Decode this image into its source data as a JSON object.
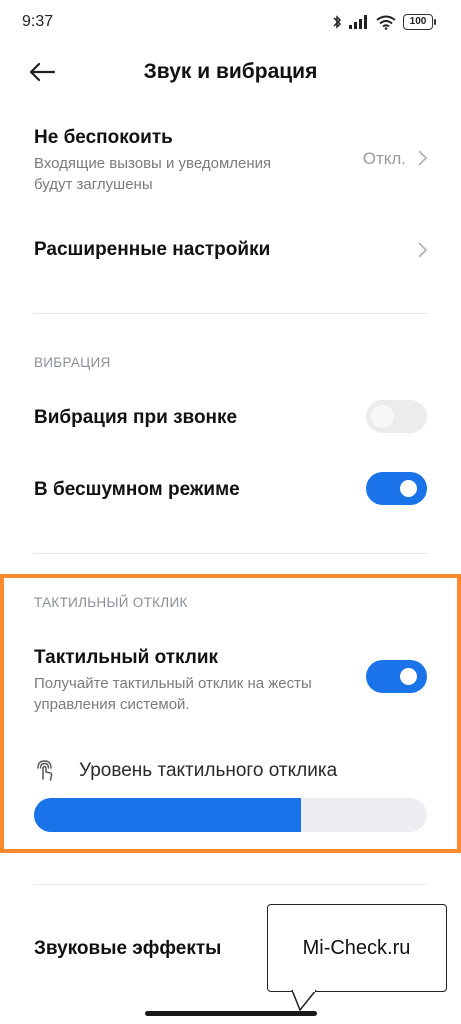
{
  "status_bar": {
    "time": "9:37",
    "battery": "100",
    "icons": [
      "bluetooth-icon",
      "signal-icon",
      "wifi-icon",
      "battery-icon"
    ]
  },
  "header": {
    "title": "Звук и вибрация",
    "back_icon": "arrow-left-icon"
  },
  "dnd": {
    "title": "Не беспокоить",
    "desc_line1": "Входящие вызовы и уведомления",
    "desc_line2": "будут заглушены",
    "value": "Откл."
  },
  "advanced": {
    "title": "Расширенные настройки"
  },
  "vibration_section": {
    "label": "ВИБРАЦИЯ",
    "ring_vibration": {
      "title": "Вибрация при звонке",
      "enabled": false
    },
    "silent_vibration": {
      "title": "В бесшумном режиме",
      "enabled": true
    }
  },
  "haptic_section": {
    "label": "ТАКТИЛЬНЫЙ ОТКЛИК",
    "haptic": {
      "title": "Тактильный отклик",
      "desc_line1": "Получайте тактильный отклик на жесты",
      "desc_line2": "управления системой.",
      "enabled": true
    },
    "level": {
      "label": "Уровень тактильного отклика",
      "icon": "touch-vibration-icon",
      "value_fraction": 0.68
    }
  },
  "sound_effects": {
    "title": "Звуковые эффекты"
  },
  "watermark": {
    "text": "Mi-Check.ru"
  },
  "colors": {
    "accent": "#1a73e8",
    "highlight": "#fd8a2f",
    "toggle_off": "#ececec"
  }
}
